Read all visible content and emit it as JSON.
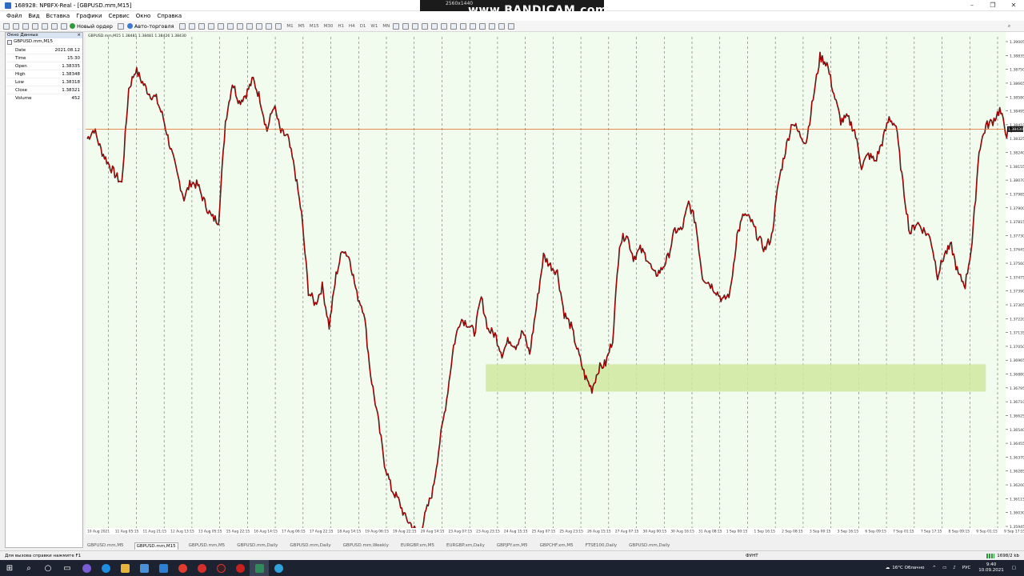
{
  "window": {
    "title": "168928: NPBFX-Real - [GBPUSD.mm,M15]",
    "icon": "metatrader-icon",
    "controls": [
      "–",
      "❐",
      "✕"
    ]
  },
  "recorder": {
    "resolution": "2560x1440",
    "brand": "www.BANDICAM.com"
  },
  "menu": [
    "Файл",
    "Вид",
    "Вставка",
    "Графики",
    "Сервис",
    "Окно",
    "Справка"
  ],
  "toolbar": {
    "new_order": "Новый ордер",
    "auto_trading": "Авто-торговля",
    "timeframes": [
      "M1",
      "M5",
      "M15",
      "M30",
      "H1",
      "H4",
      "D1",
      "W1",
      "MN"
    ]
  },
  "data_window": {
    "title": "Окно Данных",
    "symbol": "GBPUSD.mm,M15",
    "rows": [
      {
        "label": "Date",
        "value": "2021.08.12"
      },
      {
        "label": "Time",
        "value": "15:30"
      },
      {
        "label": "Open",
        "value": "1.38335"
      },
      {
        "label": "High",
        "value": "1.38348"
      },
      {
        "label": "Low",
        "value": "1.38318"
      },
      {
        "label": "Close",
        "value": "1.38321"
      },
      {
        "label": "Volume",
        "value": "452"
      }
    ]
  },
  "chart": {
    "header": "GBPUSD.mm,M15  1.38481 1.38481 1.38426 1.38430",
    "current_price": "1.38430",
    "price_labels": [
      "1.39005",
      "1.38835",
      "1.38750",
      "1.38665",
      "1.38580",
      "1.38495",
      "1.38410",
      "1.38325",
      "1.38240",
      "1.38155",
      "1.38070",
      "1.37985",
      "1.37900",
      "1.37815",
      "1.37730",
      "1.37645",
      "1.37560",
      "1.37475",
      "1.37390",
      "1.37305",
      "1.37220",
      "1.37135",
      "1.37050",
      "1.36965",
      "1.36880",
      "1.36795",
      "1.36710",
      "1.36625",
      "1.36540",
      "1.36455",
      "1.36370",
      "1.36285",
      "1.36200",
      "1.36115",
      "1.36030",
      "1.35945"
    ],
    "time_labels": [
      "10 Aug 2021",
      "11 Aug 05:15",
      "11 Aug 21:15",
      "12 Aug 13:15",
      "13 Aug 05:15",
      "15 Aug 22:15",
      "16 Aug 14:15",
      "17 Aug 06:15",
      "17 Aug 22:15",
      "18 Aug 14:15",
      "19 Aug 06:15",
      "19 Aug 22:15",
      "20 Aug 14:15",
      "23 Aug 07:15",
      "23 Aug 23:15",
      "24 Aug 15:15",
      "25 Aug 07:15",
      "25 Aug 23:15",
      "26 Aug 15:15",
      "27 Aug 07:15",
      "30 Aug 00:15",
      "30 Aug 16:15",
      "31 Aug 08:15",
      "1 Sep 00:15",
      "1 Sep 16:15",
      "2 Sep 08:15",
      "3 Sep 00:15",
      "3 Sep 16:15",
      "6 Sep 09:15",
      "7 Sep 01:15",
      "7 Sep 17:15",
      "8 Sep 09:15",
      "9 Sep 01:15",
      "9 Sep 17:15"
    ],
    "colors": {
      "background": "#f1fcee",
      "candle": "#c40000",
      "wick": "#2a1010",
      "price_line": "#e8671a",
      "zone": "#cfe7a0",
      "grid": "#6b6b6b"
    }
  },
  "chart_data": {
    "type": "line",
    "series": [
      {
        "values": [
          1.3837,
          1.3843,
          1.383,
          1.3822,
          1.3815,
          1.3809,
          1.3868,
          1.388,
          1.3872,
          1.3865,
          1.3862,
          1.385,
          1.3832,
          1.3815,
          1.38,
          1.381,
          1.3808,
          1.3797,
          1.3788,
          1.3786,
          1.3848,
          1.3872,
          1.386,
          1.3865,
          1.3874,
          1.3862,
          1.3842,
          1.3858,
          1.3841,
          1.3838,
          1.3818,
          1.379,
          1.3742,
          1.3734,
          1.3745,
          1.372,
          1.3752,
          1.3769,
          1.3762,
          1.374,
          1.373,
          1.369,
          1.3664,
          1.3635,
          1.3619,
          1.3612,
          1.3601,
          1.3596,
          1.3589,
          1.3604,
          1.3618,
          1.3648,
          1.3675,
          1.3708,
          1.3725,
          1.3722,
          1.3716,
          1.3738,
          1.3718,
          1.3715,
          1.3703,
          1.3712,
          1.3708,
          1.3717,
          1.3703,
          1.3733,
          1.3764,
          1.3758,
          1.3754,
          1.3728,
          1.372,
          1.3704,
          1.3689,
          1.3681,
          1.3694,
          1.3697,
          1.3712,
          1.3772,
          1.3778,
          1.3763,
          1.3768,
          1.3763,
          1.3752,
          1.3755,
          1.3763,
          1.378,
          1.378,
          1.3797,
          1.3785,
          1.3751,
          1.3747,
          1.3742,
          1.3736,
          1.3741,
          1.3777,
          1.379,
          1.3786,
          1.3776,
          1.3768,
          1.3776,
          1.381,
          1.383,
          1.3848,
          1.384,
          1.3835,
          1.3862,
          1.3888,
          1.3884,
          1.3865,
          1.3848,
          1.385,
          1.3842,
          1.382,
          1.3827,
          1.3823,
          1.3835,
          1.385,
          1.3845,
          1.3808,
          1.3778,
          1.3785,
          1.378,
          1.3775,
          1.3752,
          1.3765,
          1.377,
          1.3752,
          1.3746,
          1.3772,
          1.383,
          1.3845,
          1.3848,
          1.3855,
          1.384,
          1.3843
        ]
      }
    ],
    "xlim": [
      "10 Aug 2021",
      "9 Sep 17:15"
    ],
    "ylim": [
      1.35945,
      1.39005
    ],
    "price_line": 1.3843,
    "zone": {
      "from_time": "23 Aug 23:15",
      "to_time": "9 Sep 01:15",
      "price_high": 1.36965,
      "price_low": 1.36795
    },
    "grid": "vertical dashed"
  },
  "tabs": [
    "GBPUSD.mm,M5",
    "GBPUSD.mm,M15",
    "GBPUSD.mm,M5",
    "GBPUSD.mm,Daily",
    "GBPUSD.mm,Daily",
    "GBPUSD.mm,Weekly",
    "EURGBP.xm,M5",
    "EURGBP.xm,Daily",
    "GBPJPY.xm,M5",
    "GBPCHF.xm,M5",
    "FTSE100,Daily",
    "GBPUSD.mm,Daily"
  ],
  "active_tab_index": 1,
  "status": {
    "help": "Для вызова справки нажмите F1",
    "profile": "ФУНТ",
    "traffic": "1698/2 kb"
  },
  "taskbar": {
    "weather": "16°C  Облачно",
    "lang": "РУС",
    "time": "9:40",
    "date": "10.09.2021"
  }
}
